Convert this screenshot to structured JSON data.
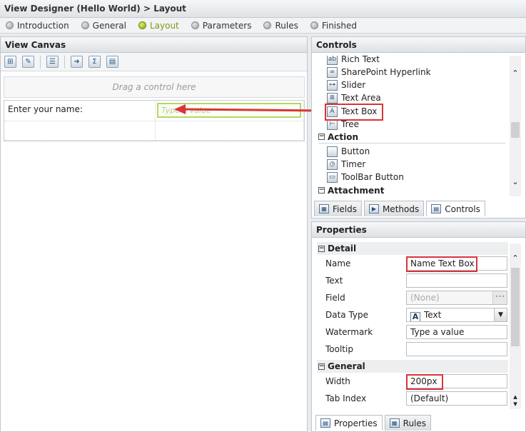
{
  "title": "View Designer (Hello World) > Layout",
  "wizard_steps": [
    {
      "label": "Introduction",
      "active": false
    },
    {
      "label": "General",
      "active": false
    },
    {
      "label": "Layout",
      "active": true
    },
    {
      "label": "Parameters",
      "active": false
    },
    {
      "label": "Rules",
      "active": false
    },
    {
      "label": "Finished",
      "active": false
    }
  ],
  "view_canvas": {
    "header": "View Canvas",
    "toolbar_icons": [
      "add-table-icon",
      "edit-table-icon",
      "insert-row-icon",
      "export-icon",
      "sum-icon",
      "properties-icon"
    ],
    "drop_zone": "Drag a control here",
    "label_cell": "Enter your name:",
    "textbox_watermark": "Type a value"
  },
  "controls": {
    "header": "Controls",
    "items": [
      {
        "label": "Rich Text",
        "icon": "rich-text-icon",
        "glyph": "ab|"
      },
      {
        "label": "SharePoint Hyperlink",
        "icon": "hyperlink-icon",
        "glyph": "🔗"
      },
      {
        "label": "Slider",
        "icon": "slider-icon",
        "glyph": "⊶"
      },
      {
        "label": "Text Area",
        "icon": "text-area-icon",
        "glyph": "≣"
      },
      {
        "label": "Text Box",
        "icon": "text-box-icon",
        "glyph": "A"
      },
      {
        "label": "Tree",
        "icon": "tree-icon",
        "glyph": "⊢"
      }
    ],
    "group_action": "Action",
    "action_items": [
      {
        "label": "Button",
        "icon": "button-icon",
        "glyph": ""
      },
      {
        "label": "Timer",
        "icon": "timer-icon",
        "glyph": "◷"
      },
      {
        "label": "ToolBar Button",
        "icon": "toolbar-button-icon",
        "glyph": "▭"
      }
    ],
    "group_attachment": "Attachment",
    "tabs": [
      "Fields",
      "Methods",
      "Controls"
    ]
  },
  "properties": {
    "header": "Properties",
    "group_detail": "Detail",
    "name_label": "Name",
    "name_value": "Name Text Box",
    "text_label": "Text",
    "text_value": "",
    "field_label": "Field",
    "field_value": "(None)",
    "datatype_label": "Data Type",
    "datatype_value": "Text",
    "watermark_label": "Watermark",
    "watermark_value": "Type a value",
    "tooltip_label": "Tooltip",
    "tooltip_value": "",
    "group_general": "General",
    "width_label": "Width",
    "width_value": "200px",
    "tabindex_label": "Tab Index",
    "tabindex_value": "(Default)",
    "tabs": [
      "Properties",
      "Rules"
    ]
  },
  "colors": {
    "highlight": "#d9343a",
    "active_step": "#7a9a19"
  }
}
